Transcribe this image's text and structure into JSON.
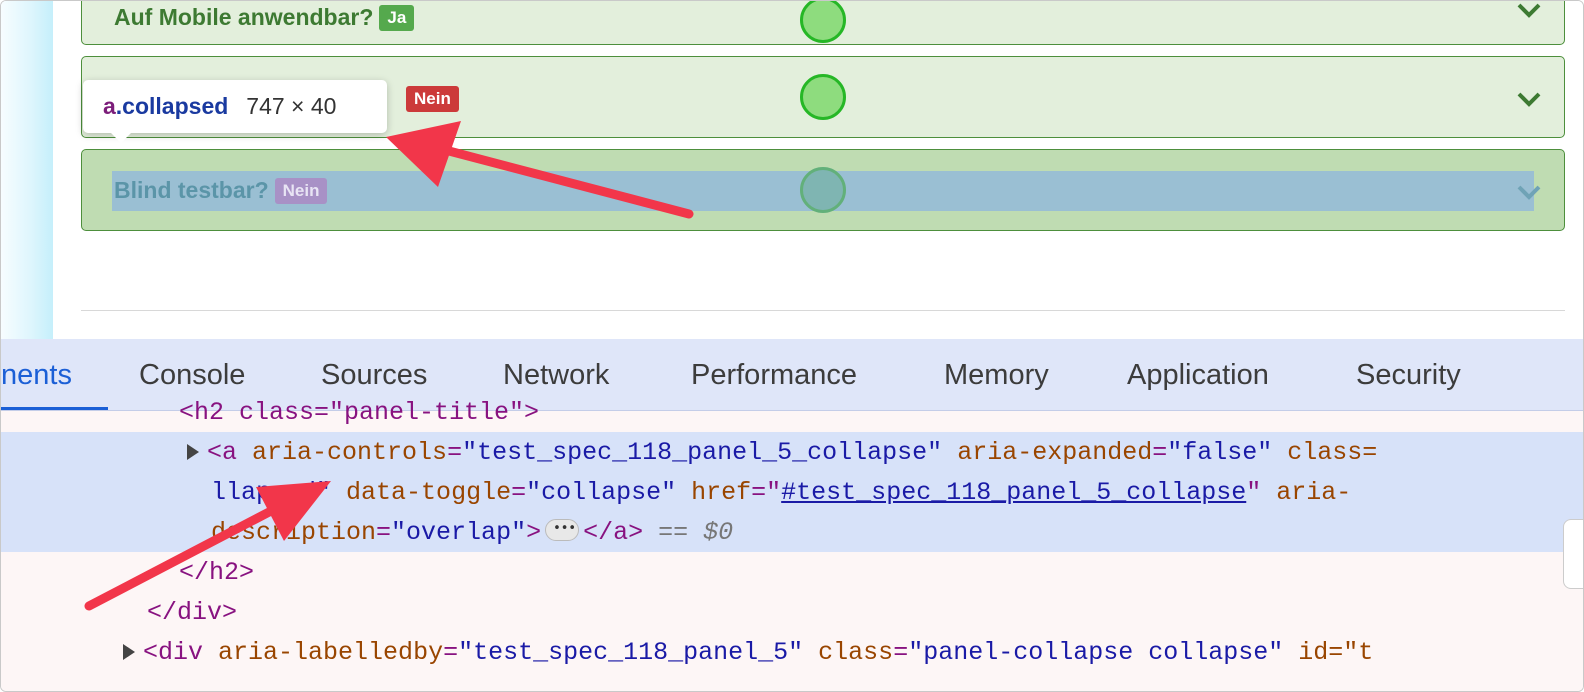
{
  "page": {
    "panels": [
      {
        "title": "Auf Mobile anwendbar?",
        "badge": "Ja"
      },
      {
        "title": "",
        "badge": "Nein"
      },
      {
        "title": "Blind testbar?",
        "badge": "Nein"
      }
    ]
  },
  "tooltip": {
    "tag": "a",
    "class": ".collapsed",
    "dimensions": "747 × 40"
  },
  "devtools": {
    "tabs": [
      {
        "label": "nents",
        "active": true
      },
      {
        "label": "Console"
      },
      {
        "label": "Sources"
      },
      {
        "label": "Network"
      },
      {
        "label": "Performance"
      },
      {
        "label": "Memory"
      },
      {
        "label": "Application"
      },
      {
        "label": "Security"
      }
    ],
    "code": {
      "line0": "<h2 class=\"panel-title\">",
      "line1": {
        "open": "<a",
        "a1n": "aria-controls",
        "a1v": "\"test_spec_118_panel_5_collapse\"",
        "a2n": "aria-expanded",
        "a2v": "\"false\"",
        "a3n": "class="
      },
      "line2": {
        "cont": "llapsed\"",
        "a1n": "data-toggle",
        "a1v": "\"collapse\"",
        "a2n": "href",
        "a2v": "#test_spec_118_panel_5_collapse",
        "a3n": "aria-"
      },
      "line3": {
        "cont": "description",
        "v": "\"overlap\"",
        "close": "</a>",
        "eq": "==",
        "ref": "$0"
      },
      "line4": "</h2>",
      "line5": "</div>",
      "line6": {
        "open": "<div",
        "a1n": "aria-labelledby",
        "a1v": "\"test_spec_118_panel_5\"",
        "a2n": "class",
        "a2v": "\"panel-collapse collapse\"",
        "a3n": "id=\"t"
      }
    }
  },
  "colors": {
    "accent": "#1b5fd6",
    "panel_bg": "#e3efdc",
    "panel_border": "#4d8f3c",
    "arrow": "#f2364a"
  }
}
